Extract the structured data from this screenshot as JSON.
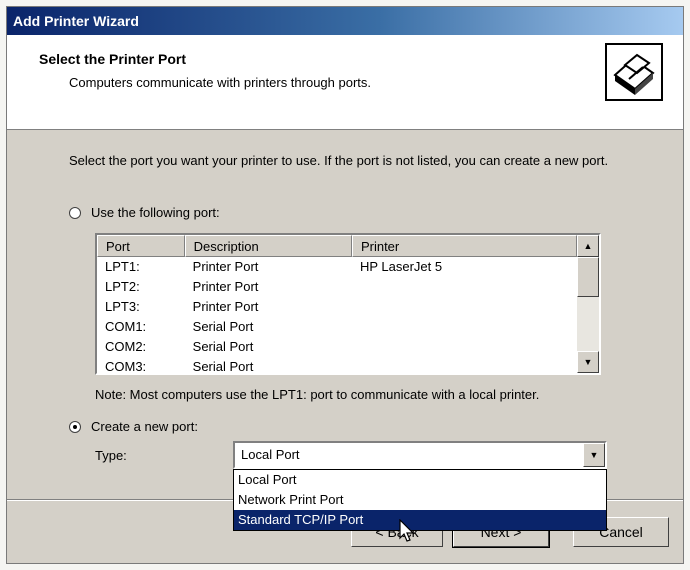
{
  "window": {
    "title": "Add Printer Wizard"
  },
  "header": {
    "title": "Select the Printer Port",
    "subtitle": "Computers communicate with printers through ports.",
    "icon": "printer-icon"
  },
  "intro_text": "Select the port you want your printer to use.  If the port is not listed, you can create a new port.",
  "use_existing": {
    "label": "Use the following port:",
    "checked": false
  },
  "port_list": {
    "columns": [
      "Port",
      "Description",
      "Printer"
    ],
    "rows": [
      [
        "LPT1:",
        "Printer Port",
        "HP LaserJet 5"
      ],
      [
        "LPT2:",
        "Printer Port",
        ""
      ],
      [
        "LPT3:",
        "Printer Port",
        ""
      ],
      [
        "COM1:",
        "Serial Port",
        ""
      ],
      [
        "COM2:",
        "Serial Port",
        ""
      ],
      [
        "COM3:",
        "Serial Port",
        ""
      ]
    ]
  },
  "note": "Note: Most computers use the LPT1: port to communicate with a local printer.",
  "create_new": {
    "label": "Create a new port:",
    "checked": true
  },
  "type": {
    "label": "Type:",
    "value": "Local Port",
    "options": [
      "Local Port",
      "Network Print Port",
      "Standard TCP/IP Port"
    ],
    "highlighted": "Standard TCP/IP Port"
  },
  "buttons": {
    "back": "< Back",
    "next": "Next >",
    "cancel": "Cancel"
  },
  "colors": {
    "title_bar": "#0a246a",
    "selection": "#0a246a",
    "face": "#d4d0c8"
  }
}
